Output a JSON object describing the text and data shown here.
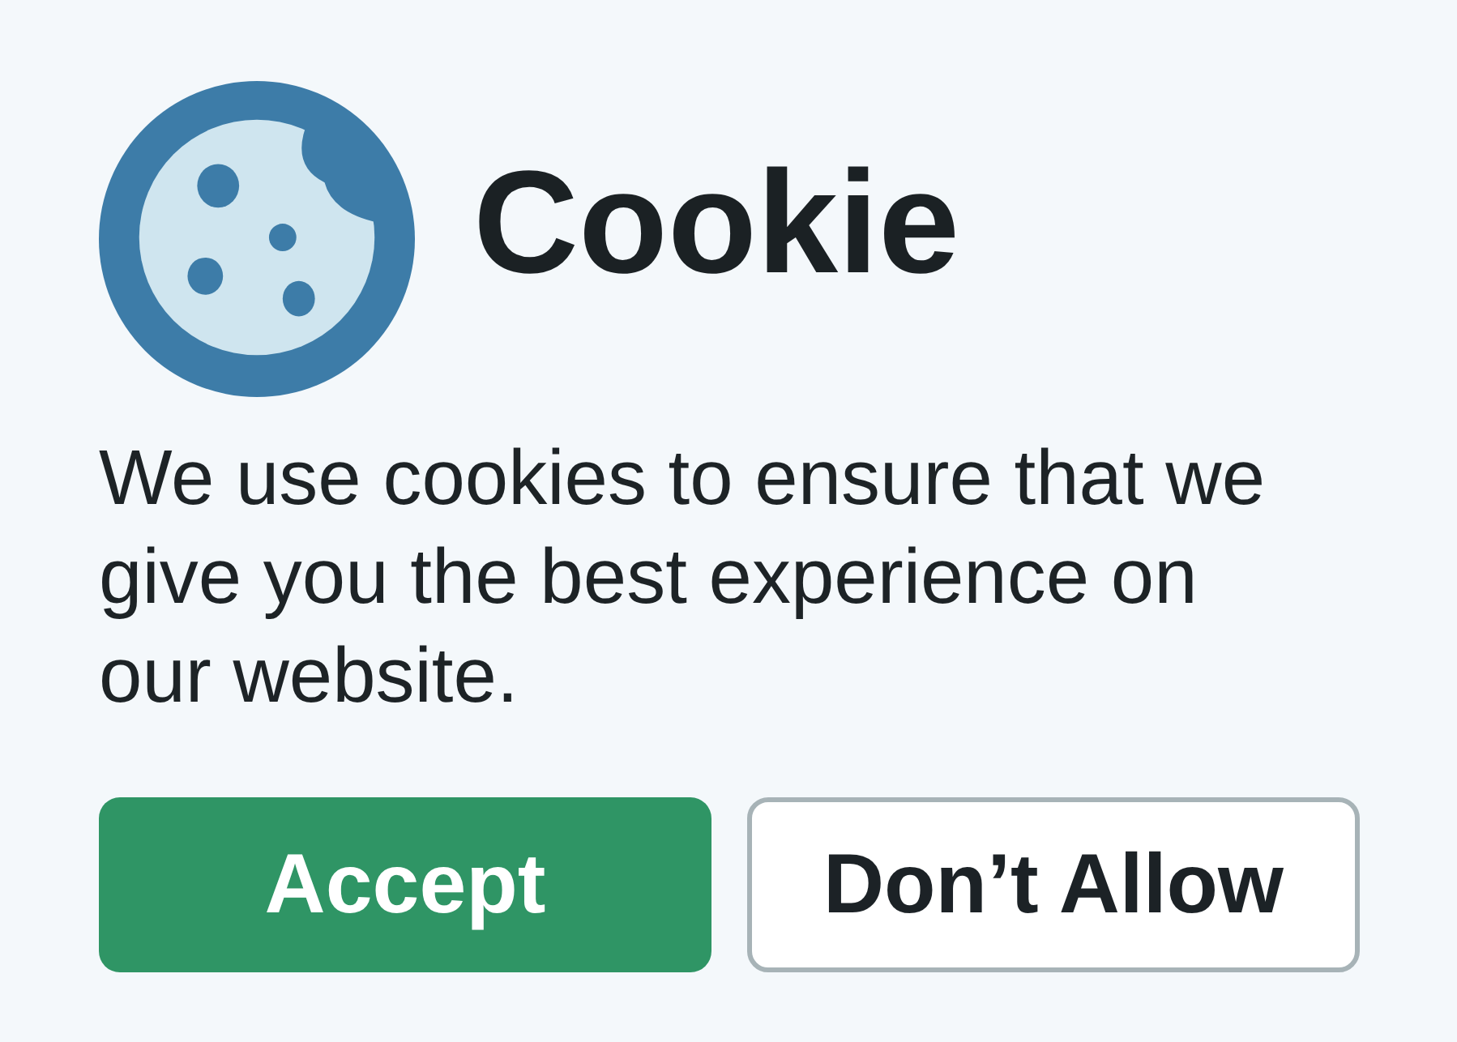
{
  "title": "Cookie",
  "message": "We use cookies to ensure that we give you the best experience on our website.",
  "buttons": [
    {
      "label": "Accept",
      "kind": "primary"
    },
    {
      "label": "Don’t Allow",
      "kind": "secondary"
    }
  ]
}
